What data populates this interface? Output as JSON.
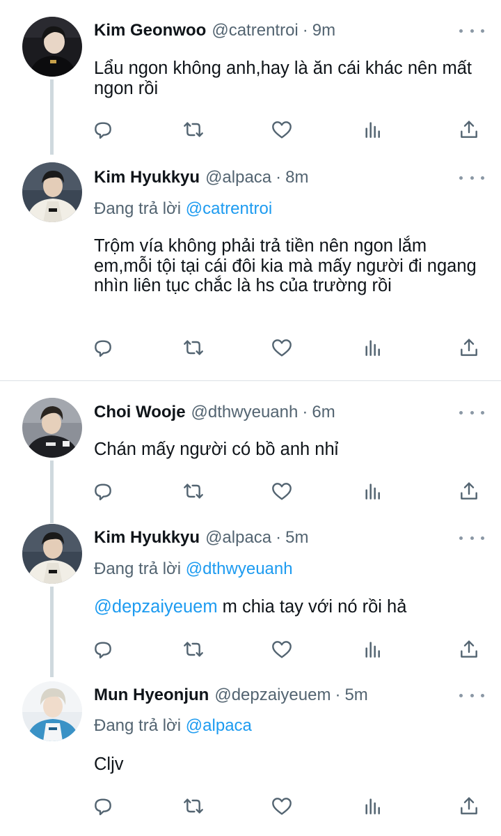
{
  "tweets": [
    {
      "name": "Kim Geonwoo",
      "handle": "@catrentroi",
      "dot": "·",
      "time": "9m",
      "reply_prefix": "",
      "reply_to": "",
      "mention": "",
      "text": "Lẩu ngon không anh,hay là ăn cái khác nên mất ngon rồi"
    },
    {
      "name": "Kim Hyukkyu",
      "handle": "@alpaca",
      "dot": "·",
      "time": "8m",
      "reply_prefix": "Đang trả lời ",
      "reply_to": "@catrentroi",
      "mention": "",
      "text": "Trộm vía không phải trả tiền nên ngon lắm em,mỗi tội tại cái đôi kia mà mấy người đi ngang nhìn liên tục chắc là hs của trường rồi"
    },
    {
      "name": "Choi Wooje",
      "handle": "@dthwyeuanh",
      "dot": "·",
      "time": "6m",
      "reply_prefix": "",
      "reply_to": "",
      "mention": "",
      "text": "Chán mấy người có bồ anh nhỉ"
    },
    {
      "name": "Kim Hyukkyu",
      "handle": "@alpaca",
      "dot": "·",
      "time": "5m",
      "reply_prefix": "Đang trả lời ",
      "reply_to": "@dthwyeuanh",
      "mention": "@depzaiyeuem",
      "text": " m chia tay với nó rồi hả"
    },
    {
      "name": "Mun Hyeonjun",
      "handle": "@depzaiyeuem",
      "dot": "·",
      "time": "5m",
      "reply_prefix": "Đang trả lời ",
      "reply_to": "@alpaca",
      "mention": "",
      "text": "Cljv"
    }
  ],
  "icons": {
    "reply": "reply-icon",
    "retweet": "retweet-icon",
    "like": "heart-icon",
    "views": "views-icon",
    "share": "share-icon",
    "more": "more-icon"
  },
  "colors": {
    "text": "#0f1419",
    "secondary": "#536471",
    "mention": "#1d9bf0",
    "thread_line": "#cfd9de"
  }
}
